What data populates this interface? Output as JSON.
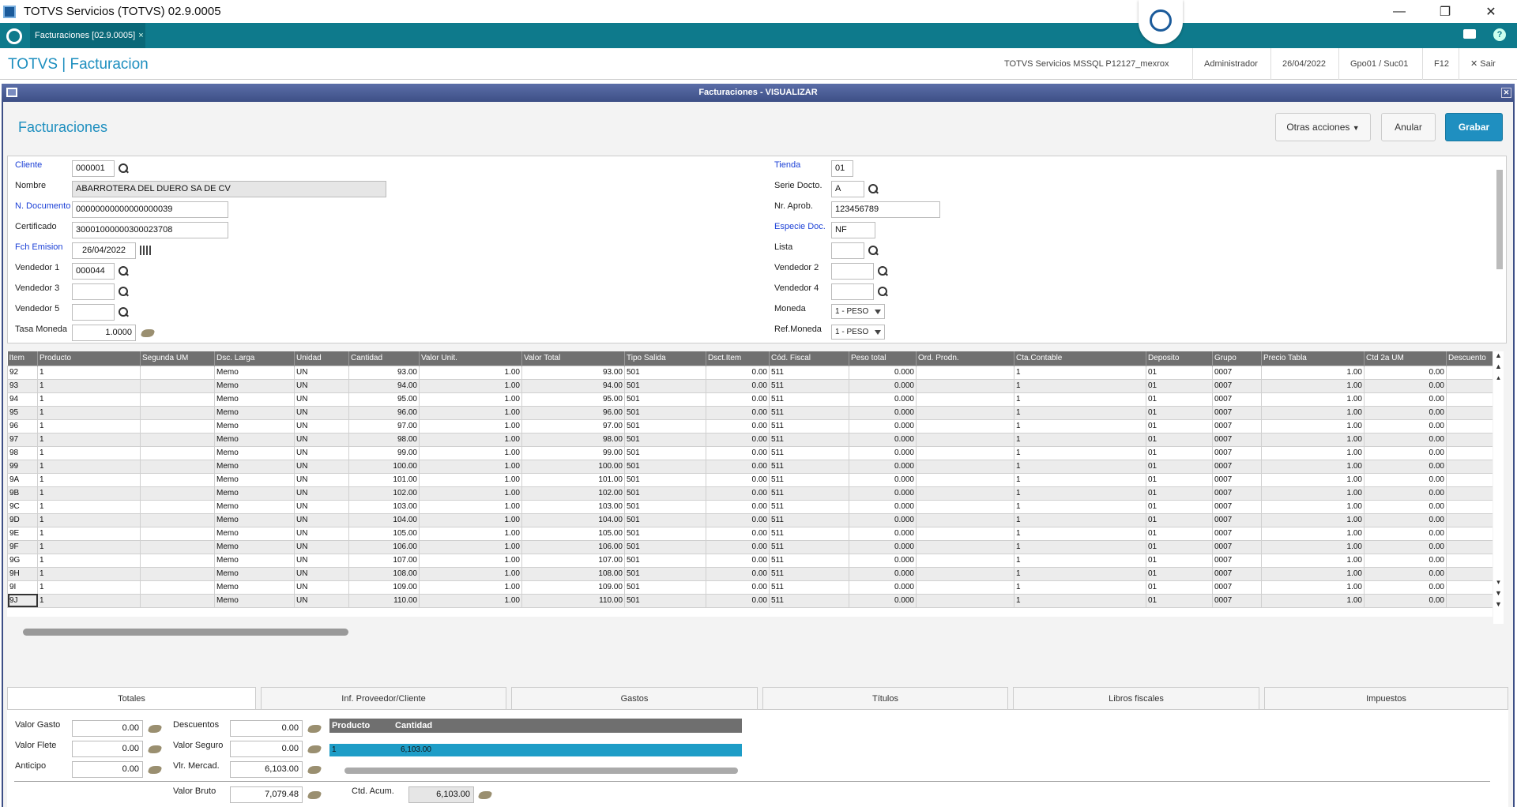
{
  "window": {
    "title": "TOTVS Servicios (TOTVS) 02.9.0005"
  },
  "tab": {
    "label": "Facturaciones [02.9.0005]",
    "close": "×"
  },
  "header": {
    "brand": "TOTVS | Facturacion",
    "server": "TOTVS Servicios MSSQL P12127_mexrox",
    "user": "Administrador",
    "date": "26/04/2022",
    "branch": "Gpo01 / Suc01",
    "key": "F12",
    "exit": "Sair"
  },
  "dialog": {
    "title": "Facturaciones - VISUALIZAR"
  },
  "page": {
    "title": "Facturaciones"
  },
  "actions": {
    "otras": "Otras acciones",
    "anular": "Anular",
    "grabar": "Grabar"
  },
  "form": {
    "cliente_lbl": "Cliente",
    "cliente": "000001",
    "nombre_lbl": "Nombre",
    "nombre": "ABARROTERA DEL DUERO SA DE CV",
    "ndoc_lbl": "N. Documento",
    "ndoc": "00000000000000000039",
    "cert_lbl": "Certificado",
    "cert": "30001000000300023708",
    "fch_lbl": "Fch Emision",
    "fch": "26/04/2022",
    "vend1_lbl": "Vendedor 1",
    "vend1": "000044",
    "vend3_lbl": "Vendedor 3",
    "vend5_lbl": "Vendedor 5",
    "tasa_lbl": "Tasa Moneda",
    "tasa": "1.0000",
    "tienda_lbl": "Tienda",
    "tienda": "01",
    "serie_lbl": "Serie Docto.",
    "serie": "A",
    "nraprob_lbl": "Nr. Aprob.",
    "nraprob": "123456789",
    "especie_lbl": "Especie Doc.",
    "especie": "NF",
    "lista_lbl": "Lista",
    "vend2_lbl": "Vendedor 2",
    "vend4_lbl": "Vendedor 4",
    "moneda_lbl": "Moneda",
    "moneda": "1 - PESO",
    "refmoneda_lbl": "Ref.Moneda",
    "refmoneda": "1 - PESO"
  },
  "grid": {
    "columns": [
      "Item",
      "Producto",
      "Segunda UM",
      "Dsc. Larga",
      "Unidad",
      "Cantidad",
      "Valor Unit.",
      "Valor Total",
      "Tipo Salida",
      "Dsct.Item",
      "Cód. Fiscal",
      "Peso total",
      "Ord. Prodn.",
      "Cta.Contable",
      "Deposito",
      "Grupo",
      "Precio Tabla",
      "Ctd 2a UM",
      "Descuento"
    ],
    "rows": [
      [
        "92",
        "1",
        "",
        "Memo",
        "UN",
        "93.00",
        "1.00",
        "93.00",
        "501",
        "0.00",
        "511",
        "0.000",
        "",
        "1",
        "01",
        "0007",
        "1.00",
        "0.00",
        ""
      ],
      [
        "93",
        "1",
        "",
        "Memo",
        "UN",
        "94.00",
        "1.00",
        "94.00",
        "501",
        "0.00",
        "511",
        "0.000",
        "",
        "1",
        "01",
        "0007",
        "1.00",
        "0.00",
        ""
      ],
      [
        "94",
        "1",
        "",
        "Memo",
        "UN",
        "95.00",
        "1.00",
        "95.00",
        "501",
        "0.00",
        "511",
        "0.000",
        "",
        "1",
        "01",
        "0007",
        "1.00",
        "0.00",
        ""
      ],
      [
        "95",
        "1",
        "",
        "Memo",
        "UN",
        "96.00",
        "1.00",
        "96.00",
        "501",
        "0.00",
        "511",
        "0.000",
        "",
        "1",
        "01",
        "0007",
        "1.00",
        "0.00",
        ""
      ],
      [
        "96",
        "1",
        "",
        "Memo",
        "UN",
        "97.00",
        "1.00",
        "97.00",
        "501",
        "0.00",
        "511",
        "0.000",
        "",
        "1",
        "01",
        "0007",
        "1.00",
        "0.00",
        ""
      ],
      [
        "97",
        "1",
        "",
        "Memo",
        "UN",
        "98.00",
        "1.00",
        "98.00",
        "501",
        "0.00",
        "511",
        "0.000",
        "",
        "1",
        "01",
        "0007",
        "1.00",
        "0.00",
        ""
      ],
      [
        "98",
        "1",
        "",
        "Memo",
        "UN",
        "99.00",
        "1.00",
        "99.00",
        "501",
        "0.00",
        "511",
        "0.000",
        "",
        "1",
        "01",
        "0007",
        "1.00",
        "0.00",
        ""
      ],
      [
        "99",
        "1",
        "",
        "Memo",
        "UN",
        "100.00",
        "1.00",
        "100.00",
        "501",
        "0.00",
        "511",
        "0.000",
        "",
        "1",
        "01",
        "0007",
        "1.00",
        "0.00",
        ""
      ],
      [
        "9A",
        "1",
        "",
        "Memo",
        "UN",
        "101.00",
        "1.00",
        "101.00",
        "501",
        "0.00",
        "511",
        "0.000",
        "",
        "1",
        "01",
        "0007",
        "1.00",
        "0.00",
        ""
      ],
      [
        "9B",
        "1",
        "",
        "Memo",
        "UN",
        "102.00",
        "1.00",
        "102.00",
        "501",
        "0.00",
        "511",
        "0.000",
        "",
        "1",
        "01",
        "0007",
        "1.00",
        "0.00",
        ""
      ],
      [
        "9C",
        "1",
        "",
        "Memo",
        "UN",
        "103.00",
        "1.00",
        "103.00",
        "501",
        "0.00",
        "511",
        "0.000",
        "",
        "1",
        "01",
        "0007",
        "1.00",
        "0.00",
        ""
      ],
      [
        "9D",
        "1",
        "",
        "Memo",
        "UN",
        "104.00",
        "1.00",
        "104.00",
        "501",
        "0.00",
        "511",
        "0.000",
        "",
        "1",
        "01",
        "0007",
        "1.00",
        "0.00",
        ""
      ],
      [
        "9E",
        "1",
        "",
        "Memo",
        "UN",
        "105.00",
        "1.00",
        "105.00",
        "501",
        "0.00",
        "511",
        "0.000",
        "",
        "1",
        "01",
        "0007",
        "1.00",
        "0.00",
        ""
      ],
      [
        "9F",
        "1",
        "",
        "Memo",
        "UN",
        "106.00",
        "1.00",
        "106.00",
        "501",
        "0.00",
        "511",
        "0.000",
        "",
        "1",
        "01",
        "0007",
        "1.00",
        "0.00",
        ""
      ],
      [
        "9G",
        "1",
        "",
        "Memo",
        "UN",
        "107.00",
        "1.00",
        "107.00",
        "501",
        "0.00",
        "511",
        "0.000",
        "",
        "1",
        "01",
        "0007",
        "1.00",
        "0.00",
        ""
      ],
      [
        "9H",
        "1",
        "",
        "Memo",
        "UN",
        "108.00",
        "1.00",
        "108.00",
        "501",
        "0.00",
        "511",
        "0.000",
        "",
        "1",
        "01",
        "0007",
        "1.00",
        "0.00",
        ""
      ],
      [
        "9I",
        "1",
        "",
        "Memo",
        "UN",
        "109.00",
        "1.00",
        "109.00",
        "501",
        "0.00",
        "511",
        "0.000",
        "",
        "1",
        "01",
        "0007",
        "1.00",
        "0.00",
        ""
      ],
      [
        "9J",
        "1",
        "",
        "Memo",
        "UN",
        "110.00",
        "1.00",
        "110.00",
        "501",
        "0.00",
        "511",
        "0.000",
        "",
        "1",
        "01",
        "0007",
        "1.00",
        "0.00",
        ""
      ]
    ]
  },
  "tabs": [
    "Totales",
    "Inf. Proveedor/Cliente",
    "Gastos",
    "Títulos",
    "Libros fiscales",
    "Impuestos"
  ],
  "totales": {
    "gasto_lbl": "Valor Gasto",
    "gasto": "0.00",
    "flete_lbl": "Valor Flete",
    "flete": "0.00",
    "anticipo_lbl": "Anticipo",
    "anticipo": "0.00",
    "desc_lbl": "Descuentos",
    "desc": "0.00",
    "seguro_lbl": "Valor Seguro",
    "seguro": "0.00",
    "mercad_lbl": "Vlr. Mercad.",
    "mercad": "6,103.00",
    "bruto_lbl": "Valor Bruto",
    "bruto": "7,079.48",
    "ctdacum_lbl": "Ctd. Acum.",
    "ctdacum": "6,103.00",
    "mini": {
      "h1": "Producto",
      "h2": "Cantidad",
      "c1": "1",
      "c2": "6,103.00"
    }
  }
}
